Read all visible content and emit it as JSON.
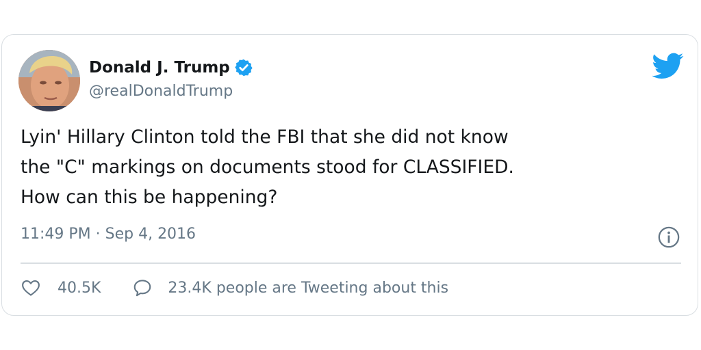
{
  "user": {
    "display_name": "Donald J. Trump",
    "handle": "@realDonaldTrump",
    "verified": true,
    "avatar_icon": "profile-photo"
  },
  "tweet": {
    "lines": [
      "Lyin' Hillary Clinton told the FBI that she did not know",
      "the \"C\" markings on documents stood for CLASSIFIED.",
      "How can this be happening?"
    ],
    "timestamp": "11:49 PM · Sep 4, 2016"
  },
  "actions": {
    "likes": "40.5K",
    "tweeting_text": "23.4K people are Tweeting about this"
  },
  "icons": {
    "brand": "twitter-bird-icon",
    "verified": "verified-badge-icon",
    "info": "info-icon",
    "like": "heart-icon",
    "reply": "speech-bubble-icon"
  },
  "colors": {
    "brand": "#1da1f2",
    "text_primary": "#14171a",
    "text_secondary": "#657786",
    "border": "#d9dee2"
  }
}
